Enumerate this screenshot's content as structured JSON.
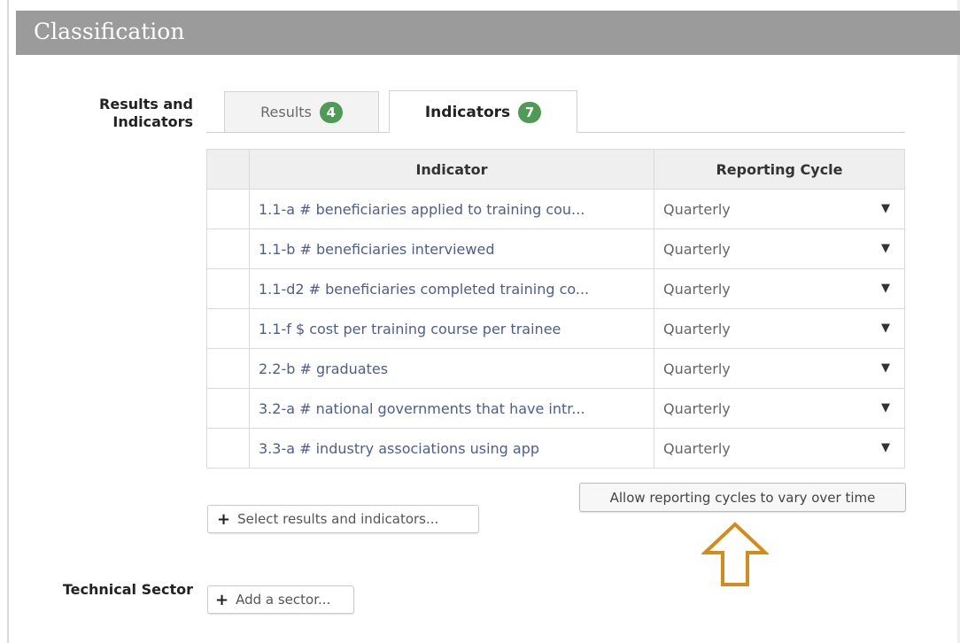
{
  "section": {
    "title": "Classification"
  },
  "results_indicators": {
    "label": "Results and Indicators",
    "tabs": [
      {
        "label": "Results",
        "count": "4"
      },
      {
        "label": "Indicators",
        "count": "7"
      }
    ],
    "table": {
      "headers": [
        "Indicator",
        "Reporting Cycle"
      ],
      "rows": [
        {
          "indicator": "1.1-a # beneficiaries applied to training cou...",
          "cycle": "Quarterly"
        },
        {
          "indicator": "1.1-b # beneficiaries interviewed",
          "cycle": "Quarterly"
        },
        {
          "indicator": "1.1-d2 # beneficiaries completed training co...",
          "cycle": "Quarterly"
        },
        {
          "indicator": "1.1-f $ cost per training course per trainee",
          "cycle": "Quarterly"
        },
        {
          "indicator": "2.2-b # graduates",
          "cycle": "Quarterly"
        },
        {
          "indicator": "3.2-a # national governments that have intr...",
          "cycle": "Quarterly"
        },
        {
          "indicator": "3.3-a # industry associations using app",
          "cycle": "Quarterly"
        }
      ]
    },
    "allow_button": "Allow reporting cycles to vary over time",
    "select_button": "Select results and indicators..."
  },
  "technical_sector": {
    "label": "Technical Sector",
    "add_button": "Add a sector..."
  },
  "icons": {
    "plus": "plus-icon",
    "dropdown": "dropdown-caret-icon",
    "annotation": "up-arrow-annotation-icon"
  },
  "colors": {
    "header_bg": "#9b9b9b",
    "badge": "#4f9a55",
    "link_text": "#4d5d93",
    "arrow": "#d38b1c"
  }
}
